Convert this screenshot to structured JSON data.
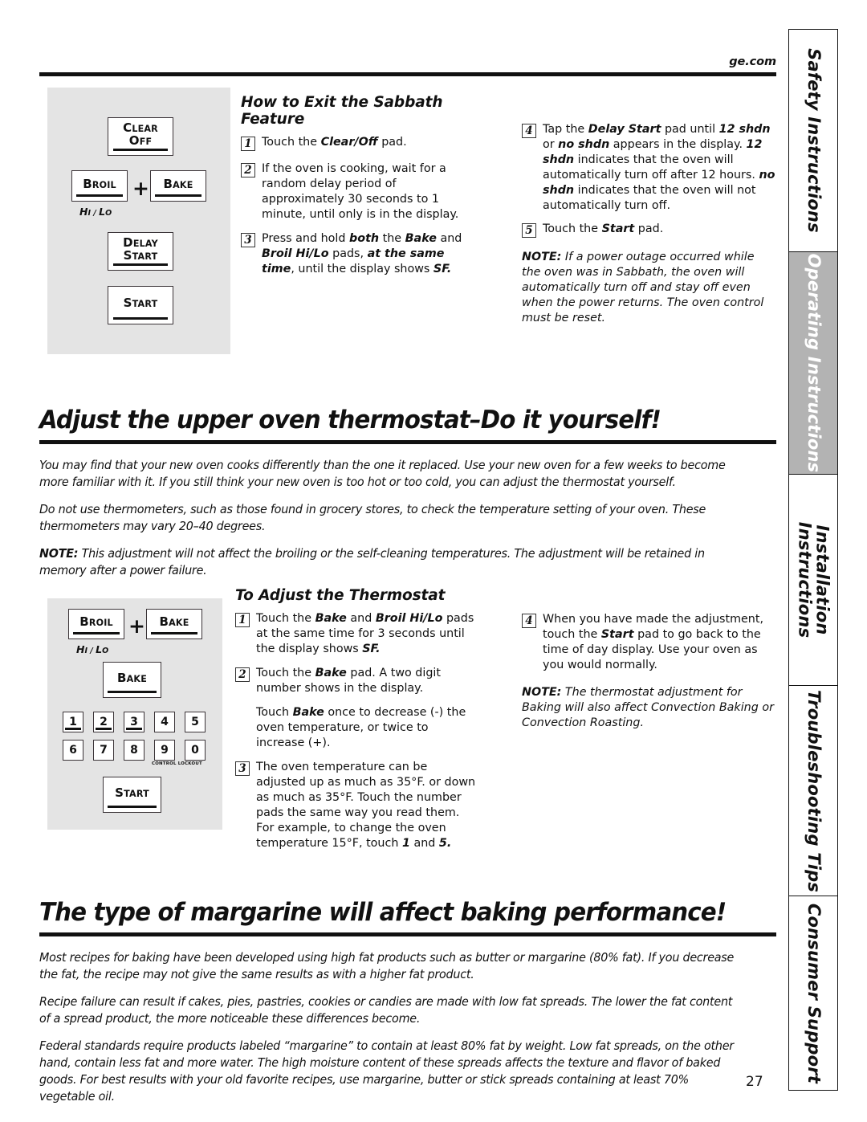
{
  "header": {
    "site_url": "ge.com"
  },
  "sidebar": {
    "tabs": [
      {
        "label": "Safety Instructions",
        "active": false
      },
      {
        "label": "Operating Instructions",
        "active": true
      },
      {
        "label": "Installation\nInstructions",
        "active": false
      },
      {
        "label": "Troubleshooting Tips",
        "active": false
      },
      {
        "label": "Consumer Support",
        "active": false
      }
    ]
  },
  "sabbath": {
    "heading": "How to Exit the Sabbath Feature",
    "panel": {
      "pads": {
        "clear_off_line1": "C",
        "clear_off_line1b": "LEAR",
        "clear_off_line2": "O",
        "clear_off_line2b": "FF",
        "broil_cap": "B",
        "broil_rest": "ROIL",
        "plus": "+",
        "bake_cap": "B",
        "bake_rest": "AKE",
        "hilo_h": "H",
        "hilo_i": "I",
        "hilo_slash": " / ",
        "hilo_l": "L",
        "hilo_o": "O",
        "delay_cap": "D",
        "delay_rest": "ELAY",
        "start_cap": "S",
        "start_rest": "TART"
      }
    },
    "steps": [
      {
        "num": "1",
        "parts": [
          {
            "t": "Touch the ",
            "b": false
          },
          {
            "t": "Clear/Off",
            "b": true
          },
          {
            "t": " pad.",
            "b": false
          }
        ]
      },
      {
        "num": "2",
        "parts": [
          {
            "t": "If the oven is cooking, wait for a random delay period of approximately 30 seconds to 1 minute, until only      is in the display.",
            "b": false
          }
        ]
      },
      {
        "num": "3",
        "parts": [
          {
            "t": "Press and hold ",
            "b": false
          },
          {
            "t": "both",
            "b": true
          },
          {
            "t": " the ",
            "b": false
          },
          {
            "t": "Bake",
            "b": true
          },
          {
            "t": " and ",
            "b": false
          },
          {
            "t": "Broil Hi/Lo",
            "b": true
          },
          {
            "t": " pads, ",
            "b": false
          },
          {
            "t": "at the same time",
            "b": true
          },
          {
            "t": ", until the display shows ",
            "b": false
          },
          {
            "t": "SF.",
            "b": true
          }
        ]
      },
      {
        "num": "4",
        "parts": [
          {
            "t": "Tap the ",
            "b": false
          },
          {
            "t": "Delay Start",
            "b": true
          },
          {
            "t": " pad until ",
            "b": false
          },
          {
            "t": "12 shdn",
            "b": true
          },
          {
            "t": " or ",
            "b": false
          },
          {
            "t": "no shdn",
            "b": true
          },
          {
            "t": " appears in the display. ",
            "b": false
          },
          {
            "t": "12 shdn",
            "b": true
          },
          {
            "t": " indicates that the oven will automatically turn off after 12 hours. ",
            "b": false
          },
          {
            "t": "no shdn",
            "b": true
          },
          {
            "t": " indicates that the oven will not automatically turn off.",
            "b": false
          }
        ]
      },
      {
        "num": "5",
        "parts": [
          {
            "t": "Touch the ",
            "b": false
          },
          {
            "t": "Start",
            "b": true
          },
          {
            "t": " pad.",
            "b": false
          }
        ]
      }
    ],
    "note": {
      "label": "NOTE:",
      "text": " If a power outage occurred while the oven was in Sabbath, the oven will automatically turn off and stay off even when the power returns. The oven control must be reset."
    }
  },
  "thermostat": {
    "heading": "Adjust the upper oven thermostat–Do it yourself!",
    "paragraphs": [
      "You may find that your new oven cooks differently than the one it replaced. Use your new oven for a few weeks to become more familiar with it. If you still think your new oven is too hot or too cold, you can adjust the thermostat yourself.",
      "Do not use thermometers, such as those found in grocery stores, to check the temperature setting of your oven. These thermometers may vary 20–40 degrees."
    ],
    "note": {
      "label": "NOTE:",
      "text": "  This adjustment will not affect the broiling or the self-cleaning temperatures. The adjustment will be retained in memory after a power failure."
    },
    "sub_heading": "To Adjust the Thermostat",
    "numpad": {
      "row1": [
        "1",
        "2",
        "3",
        "4",
        "5"
      ],
      "row2": [
        "6",
        "7",
        "8",
        "9",
        "0"
      ],
      "lockout_label": "CONTROL LOCKOUT",
      "lockout_c1": "C",
      "lockout_r1": "ONTROL",
      "lockout_c2": "L",
      "lockout_r2": "OCKOUT"
    },
    "steps": [
      {
        "num": "1",
        "parts": [
          {
            "t": "Touch the ",
            "b": false
          },
          {
            "t": "Bake",
            "b": true
          },
          {
            "t": " and ",
            "b": false
          },
          {
            "t": "Broil Hi/Lo",
            "b": true
          },
          {
            "t": " pads at the same time for 3 seconds until the display shows ",
            "b": false
          },
          {
            "t": "SF.",
            "b": true
          }
        ]
      },
      {
        "num": "2",
        "parts": [
          {
            "t": "Touch the ",
            "b": false
          },
          {
            "t": "Bake",
            "b": true
          },
          {
            "t": " pad. A two digit number shows in the display.",
            "b": false
          }
        ]
      },
      {
        "num": "",
        "parts": [
          {
            "t": "Touch ",
            "b": false
          },
          {
            "t": "Bake",
            "b": true
          },
          {
            "t": " once to decrease (-) the oven temperature, or twice to increase (+).",
            "b": false
          }
        ]
      },
      {
        "num": "3",
        "parts": [
          {
            "t": "The oven temperature can be adjusted up as much as 35°F. or down as much as 35°F. Touch the number pads the same way you read them. For example, to change the oven temperature 15°F, touch ",
            "b": false
          },
          {
            "t": "1",
            "b": true
          },
          {
            "t": " and ",
            "b": false
          },
          {
            "t": "5.",
            "b": true
          }
        ]
      },
      {
        "num": "4",
        "parts": [
          {
            "t": "When you have made the adjustment, touch the ",
            "b": false
          },
          {
            "t": "Start",
            "b": true
          },
          {
            "t": " pad to go back to the time of day display. Use your oven as you would normally.",
            "b": false
          }
        ]
      }
    ],
    "right_note": {
      "label": "NOTE:",
      "text": " The thermostat adjustment for Baking will also affect Convection Baking or Convection Roasting."
    }
  },
  "margarine": {
    "heading": "The type of margarine will affect baking performance!",
    "paragraphs": [
      "Most recipes for baking have been developed using high fat products such as butter or margarine (80% fat). If you decrease the fat, the recipe may not give the same results as with a higher fat product.",
      "Recipe failure can result if cakes, pies, pastries, cookies or candies are made with low fat spreads. The lower the fat content of a spread product, the more noticeable these differences become.",
      "Federal standards require products labeled “margarine” to contain at least 80% fat by weight. Low fat spreads, on the other hand, contain less fat and more water. The high moisture content of these spreads affects the texture and flavor of baked goods. For best results with your old favorite recipes, use margarine, butter or stick spreads containing at least 70% vegetable oil."
    ]
  },
  "footer": {
    "page_number": "27"
  }
}
